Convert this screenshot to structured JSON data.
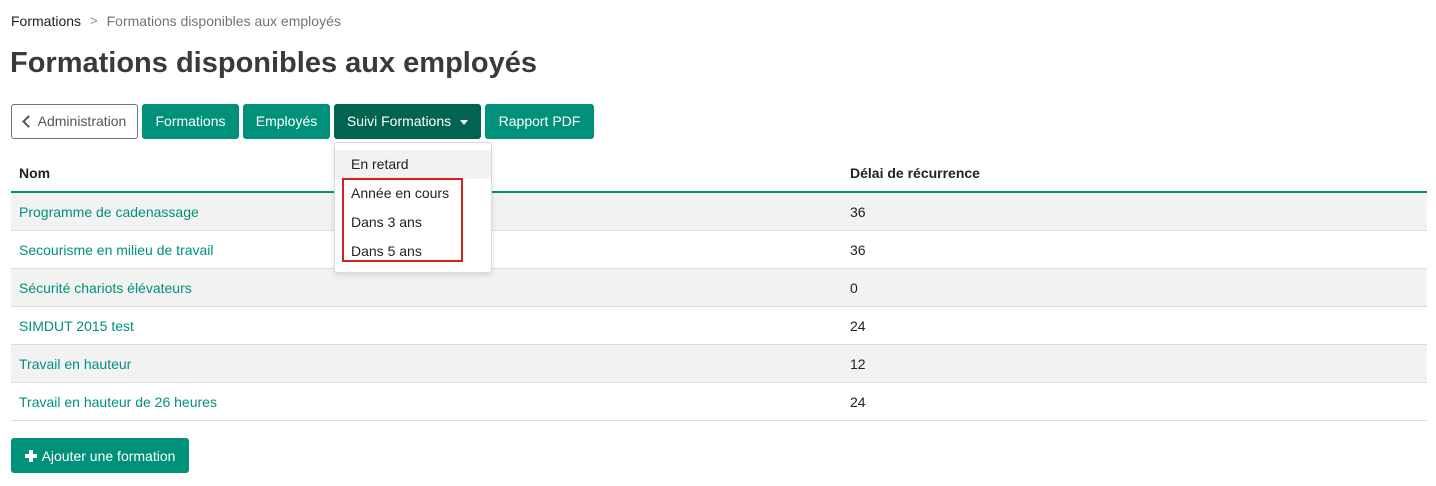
{
  "breadcrumb": {
    "root": "Formations",
    "separator": ">",
    "current": "Formations disponibles aux employés"
  },
  "page_title": "Formations disponibles aux employés",
  "toolbar": {
    "back_label": "Administration",
    "formations_label": "Formations",
    "employes_label": "Employés",
    "suivi_label": "Suivi Formations",
    "rapport_label": "Rapport PDF"
  },
  "dropdown": {
    "items": [
      "En retard",
      "Année en cours",
      "Dans 3 ans",
      "Dans 5 ans"
    ]
  },
  "table": {
    "headers": {
      "name": "Nom",
      "recurrence": "Délai de récurrence"
    },
    "rows": [
      {
        "name": "Programme de cadenassage",
        "recurrence": "36"
      },
      {
        "name": "Secourisme en milieu de travail",
        "recurrence": "36"
      },
      {
        "name": "Sécurité chariots élévateurs",
        "recurrence": "0"
      },
      {
        "name": "SIMDUT 2015 test",
        "recurrence": "24"
      },
      {
        "name": "Travail en hauteur",
        "recurrence": "12"
      },
      {
        "name": "Travail en hauteur de 26 heures",
        "recurrence": "24"
      }
    ]
  },
  "add_button_label": "Ajouter une formation",
  "colors": {
    "accent": "#00917a",
    "accent_dark": "#006450",
    "highlight": "#d42020"
  }
}
